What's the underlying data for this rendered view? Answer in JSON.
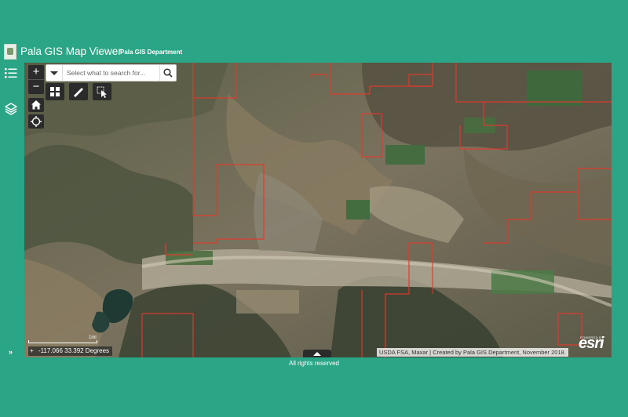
{
  "app": {
    "title": "Pala GIS Map Viewer",
    "department": "Pala GIS Department"
  },
  "rail": {
    "items": [
      {
        "name": "legend-list-icon"
      },
      {
        "name": "layers-icon"
      },
      {
        "name": "expand-chevrons-icon"
      }
    ],
    "expand_label": "»"
  },
  "map": {
    "zoom_in_label": "+",
    "zoom_out_label": "−",
    "search": {
      "placeholder": "Select what to search for..."
    },
    "tools": [
      {
        "name": "basemap-gallery-icon"
      },
      {
        "name": "measure-icon"
      },
      {
        "name": "select-icon"
      }
    ],
    "scale_label": "1mi",
    "coordinates": "-117.066 33.392 Degrees",
    "coord_toggle": "+",
    "attribution": "USDA FSA, Maxar | Created by Pala GIS Department, November 2018.",
    "esri_powered": "POWERED BY",
    "esri_logo": "esri",
    "colors": {
      "parcel_outline": "#e03a2e",
      "header_bg": "#2aa585",
      "widget_bg": "#2b2b2b"
    }
  },
  "footer": {
    "text": "All rights reserved"
  }
}
